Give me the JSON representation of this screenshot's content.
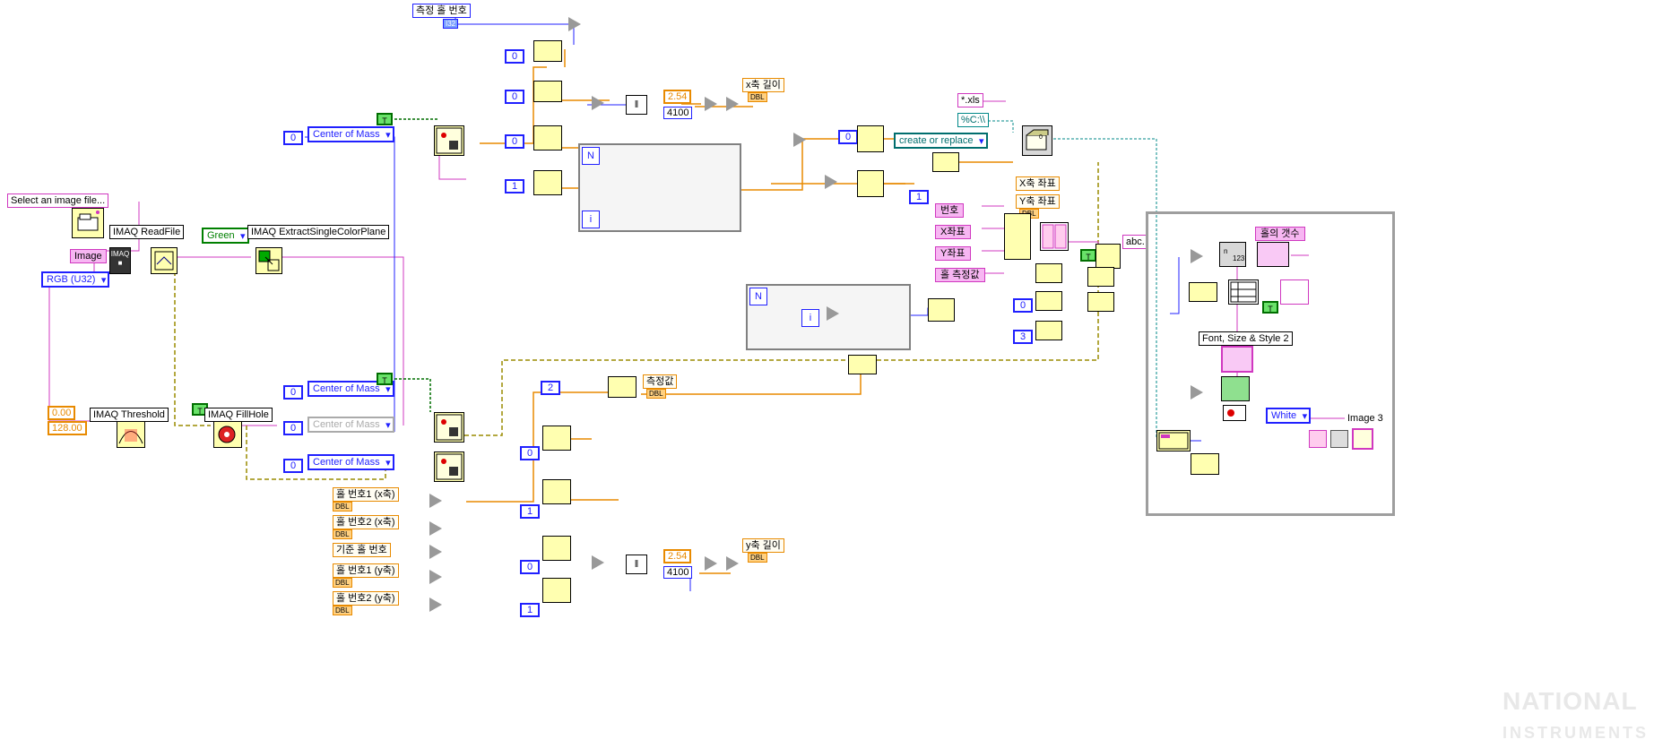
{
  "constants": {
    "select_img": "Select an image file...",
    "image": "Image",
    "rgb": "RGB (U32)",
    "imaq_read": "IMAQ ReadFile",
    "imaq_extract": "IMAQ ExtractSingleColorPlane",
    "green": "Green",
    "threshold_low": "0.00",
    "threshold_hi": "128.00",
    "imaq_thresh": "IMAQ Threshold",
    "imaq_fill": "IMAQ FillHole",
    "com1": "Center of Mass",
    "com2": "Center of Mass",
    "com_gray": "Center of Mass",
    "com3": "Center of Mass",
    "cluster_idx0": "0",
    "cluster_idx1": "0",
    "cluster_idx2": "0",
    "cluster_idx3": "0",
    "meas_hole_no": "측정 홀 번호",
    "i32": "I32",
    "true": "T",
    "idx_zero": "0",
    "idx_one": "1",
    "idx_two": "2",
    "n_sym": "N",
    "i_sym": "i",
    "x_len": "x축 길이",
    "dbl_tag": "DBL",
    "scale_a": "2.54",
    "scale_b": "4100",
    "y_len": "y축 길이",
    "x_coord": "X축 좌표",
    "y_coord": "Y축 좌표",
    "xls": "*.xls",
    "c_drive": "%C:\\\\",
    "create_rep": "create or replace",
    "number": "번호",
    "x_lbl": "X좌표",
    "y_lbl": "Y좌표",
    "hole_meas": "홀 측정값",
    "three": "3",
    "hole_no1_x": "홀 번호1 (x축)",
    "hole_no2_x": "홀 번호2 (x축)",
    "base_hole": "기준 홀 번호",
    "hole_no1_y": "홀 번호1 (y축)",
    "hole_no2_y": "홀 번호2 (y축)",
    "meas_val": "측정값",
    "hole_count": "홀의 갯수",
    "font_style": "Font, Size & Style 2",
    "white": "White",
    "image3": "Image 3",
    "abc": "abc."
  }
}
